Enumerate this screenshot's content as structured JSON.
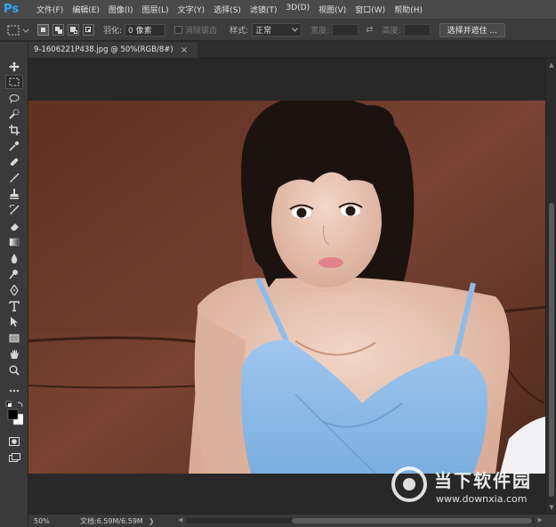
{
  "app": {
    "logo": "Ps"
  },
  "menu": [
    "文件(F)",
    "编辑(E)",
    "图像(I)",
    "图层(L)",
    "文字(Y)",
    "选择(S)",
    "滤镜(T)",
    "3D(D)",
    "视图(V)",
    "窗口(W)",
    "帮助(H)"
  ],
  "options": {
    "feather_label": "羽化:",
    "feather_value": "0 像素",
    "antialias_label": "消除锯齿",
    "style_label": "样式:",
    "style_value": "正常",
    "width_label": "宽度:",
    "height_label": "高度:",
    "select_mask_button": "选择并遮住 ..."
  },
  "document": {
    "tab_title": "9-1606221P438.jpg @ 50%(RGB/8#)",
    "close_glyph": "×"
  },
  "status": {
    "zoom": "50%",
    "doc_info": "文档:6.59M/6.59M",
    "arrow": "❯"
  },
  "watermark": {
    "title": "当下软件园",
    "url": "www.downxia.com"
  },
  "icons": {
    "tools": [
      "move-icon",
      "marquee-icon",
      "lasso-icon",
      "quick-select-icon",
      "crop-icon",
      "eyedropper-icon",
      "healing-brush-icon",
      "brush-icon",
      "clone-stamp-icon",
      "history-brush-icon",
      "eraser-icon",
      "gradient-icon",
      "blur-icon",
      "dodge-icon",
      "pen-icon",
      "type-icon",
      "path-select-icon",
      "rectangle-icon",
      "hand-icon",
      "zoom-icon",
      "more-tools-icon",
      "color-swatches-icon",
      "quick-mask-icon",
      "screen-mode-icon"
    ]
  },
  "colors": {
    "accent": "#31a8ff",
    "foreground": "#000000",
    "background": "#ffffff"
  }
}
